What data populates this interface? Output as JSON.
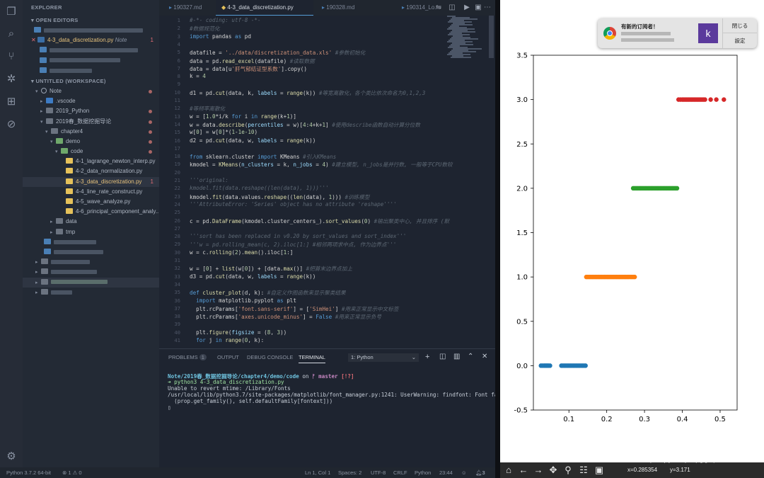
{
  "sidebar": {
    "explorer_title": "EXPLORER",
    "open_editors": "OPEN EDITORS",
    "active_file": "4-3_data_discretization.py",
    "note_label": "Note",
    "note_count": "1",
    "workspace": "UNTITLED (WORKSPACE)",
    "tree": [
      {
        "label": "Note",
        "depth": 0,
        "kind": "root",
        "dot": true
      },
      {
        "label": ".vscode",
        "depth": 1,
        "kind": "folder"
      },
      {
        "label": "2019_Python",
        "depth": 1,
        "kind": "folder",
        "dot": true
      },
      {
        "label": "2019春_数据挖掘导论",
        "depth": 1,
        "kind": "folder-open",
        "dot": true
      },
      {
        "label": "chapter4",
        "depth": 2,
        "kind": "folder-open",
        "dot": true
      },
      {
        "label": "demo",
        "depth": 3,
        "kind": "folder-open",
        "dot": true
      },
      {
        "label": "code",
        "depth": 4,
        "kind": "folder-open",
        "dot": true
      },
      {
        "label": "4-1_lagrange_newton_interp.py",
        "depth": 5,
        "kind": "py"
      },
      {
        "label": "4-2_data_normalization.py",
        "depth": 5,
        "kind": "py"
      },
      {
        "label": "4-3_data_discretization.py",
        "depth": 5,
        "kind": "py",
        "num": "1",
        "active": true
      },
      {
        "label": "4-4_line_rate_construct.py",
        "depth": 5,
        "kind": "py"
      },
      {
        "label": "4-5_wave_analyze.py",
        "depth": 5,
        "kind": "py"
      },
      {
        "label": "4-6_principal_component_analy...",
        "depth": 5,
        "kind": "py"
      },
      {
        "label": "data",
        "depth": 3,
        "kind": "folder"
      },
      {
        "label": "tmp",
        "depth": 3,
        "kind": "folder"
      }
    ],
    "outline": "OUTLINE"
  },
  "tabs": [
    "190327.md",
    "4-3_data_discretization.py",
    "190328.md",
    "190314_Lo..."
  ],
  "editor": {
    "lines": [
      [
        [
          "c",
          "#-*- coding: utf-8 -*-"
        ]
      ],
      [
        [
          "c",
          "#数据规范化"
        ]
      ],
      [
        [
          "k",
          "import"
        ],
        [
          "o",
          " pandas "
        ],
        [
          "k",
          "as"
        ],
        [
          "o",
          " pd"
        ]
      ],
      [],
      [
        [
          "o",
          "datafile = "
        ],
        [
          "s",
          "'../data/discretization_data.xls'"
        ],
        [
          "c",
          " #参数初始化"
        ]
      ],
      [
        [
          "o",
          "data = pd."
        ],
        [
          "f",
          "read_excel"
        ],
        [
          "o",
          "(datafile) "
        ],
        [
          "c",
          "#读取数据"
        ]
      ],
      [
        [
          "o",
          "data = data[u"
        ],
        [
          "s",
          "'肝气郁结证型系数'"
        ],
        [
          "o",
          "].copy()"
        ]
      ],
      [
        [
          "o",
          "k = "
        ],
        [
          "n",
          "4"
        ]
      ],
      [],
      [
        [
          "o",
          "d1 = pd."
        ],
        [
          "f",
          "cut"
        ],
        [
          "o",
          "(data, k, "
        ],
        [
          "v",
          "labels"
        ],
        [
          "o",
          " = "
        ],
        [
          "f",
          "range"
        ],
        [
          "o",
          "(k)) "
        ],
        [
          "c",
          "#等宽离散化，各个类比依次命名为0,1,2,3"
        ]
      ],
      [],
      [
        [
          "c",
          "#等频率离散化"
        ]
      ],
      [
        [
          "o",
          "w = ["
        ],
        [
          "n",
          "1.0"
        ],
        [
          "o",
          "*i/k "
        ],
        [
          "k",
          "for"
        ],
        [
          "o",
          " i "
        ],
        [
          "k",
          "in"
        ],
        [
          "o",
          " "
        ],
        [
          "f",
          "range"
        ],
        [
          "o",
          "(k+"
        ],
        [
          "n",
          "1"
        ],
        [
          "o",
          ")]"
        ]
      ],
      [
        [
          "o",
          "w = data."
        ],
        [
          "f",
          "describe"
        ],
        [
          "o",
          "("
        ],
        [
          "v",
          "percentiles"
        ],
        [
          "o",
          " = w)["
        ],
        [
          "n",
          "4"
        ],
        [
          "o",
          ":"
        ],
        [
          "n",
          "4"
        ],
        [
          "o",
          "+k+"
        ],
        [
          "n",
          "1"
        ],
        [
          "o",
          "] "
        ],
        [
          "c",
          "#使用describe函数自动计算分位数"
        ]
      ],
      [
        [
          "o",
          "w["
        ],
        [
          "n",
          "0"
        ],
        [
          "o",
          "] = w["
        ],
        [
          "n",
          "0"
        ],
        [
          "o",
          "]*("
        ],
        [
          "n",
          "1"
        ],
        [
          "o",
          "-"
        ],
        [
          "n",
          "1e-10"
        ],
        [
          "o",
          ")"
        ]
      ],
      [
        [
          "o",
          "d2 = pd."
        ],
        [
          "f",
          "cut"
        ],
        [
          "o",
          "(data, w, "
        ],
        [
          "v",
          "labels"
        ],
        [
          "o",
          " = "
        ],
        [
          "f",
          "range"
        ],
        [
          "o",
          "(k))"
        ]
      ],
      [],
      [
        [
          "k",
          "from"
        ],
        [
          "o",
          " sklearn.cluster "
        ],
        [
          "k",
          "import"
        ],
        [
          "o",
          " KMeans "
        ],
        [
          "c",
          "#引入KMeans"
        ]
      ],
      [
        [
          "o",
          "kmodel = "
        ],
        [
          "f",
          "KMeans"
        ],
        [
          "o",
          "("
        ],
        [
          "v",
          "n_clusters"
        ],
        [
          "o",
          " = k, "
        ],
        [
          "v",
          "n_jobs"
        ],
        [
          "o",
          " = "
        ],
        [
          "n",
          "4"
        ],
        [
          "o",
          ") "
        ],
        [
          "c",
          "#建立模型, n_jobs是并行数, 一般等于CPU数较"
        ]
      ],
      [],
      [
        [
          "c",
          "'''original:"
        ]
      ],
      [
        [
          "c",
          "kmodel.fit(data.reshape((len(data), 1)))'''"
        ]
      ],
      [
        [
          "o",
          "kmodel."
        ],
        [
          "f",
          "fit"
        ],
        [
          "o",
          "(data.values."
        ],
        [
          "f",
          "reshape"
        ],
        [
          "o",
          "(("
        ],
        [
          "f",
          "len"
        ],
        [
          "o",
          "(data), "
        ],
        [
          "n",
          "1"
        ],
        [
          "o",
          "))) "
        ],
        [
          "c",
          "#训练模型"
        ]
      ],
      [
        [
          "c",
          "'''AttributeError: 'Series' object has no attribute 'reshape''''"
        ]
      ],
      [],
      [
        [
          "o",
          "c = pd."
        ],
        [
          "f",
          "DataFrame"
        ],
        [
          "o",
          "(kmodel.cluster_centers_)."
        ],
        [
          "f",
          "sort_values"
        ],
        [
          "o",
          "("
        ],
        [
          "n",
          "0"
        ],
        [
          "o",
          ") "
        ],
        [
          "c",
          "#输出聚类中心, 并且排序 (默"
        ]
      ],
      [],
      [
        [
          "c",
          "'''sort has been replaced in v0.20 by sort_values and sort_index'''"
        ]
      ],
      [
        [
          "c",
          "'''w = pd.rolling_mean(c, 2).iloc[1:] #相邻两项求中点, 作为边界点'''"
        ]
      ],
      [
        [
          "o",
          "w = c."
        ],
        [
          "f",
          "rolling"
        ],
        [
          "o",
          "("
        ],
        [
          "n",
          "2"
        ],
        [
          "o",
          ")."
        ],
        [
          "f",
          "mean"
        ],
        [
          "o",
          "().iloc["
        ],
        [
          "n",
          "1"
        ],
        [
          "o",
          ":]"
        ]
      ],
      [],
      [
        [
          "o",
          "w = ["
        ],
        [
          "n",
          "0"
        ],
        [
          "o",
          "] + "
        ],
        [
          "f",
          "list"
        ],
        [
          "o",
          "(w["
        ],
        [
          "n",
          "0"
        ],
        [
          "o",
          "]) + [data."
        ],
        [
          "f",
          "max"
        ],
        [
          "o",
          "()] "
        ],
        [
          "c",
          "#把首末边界点加上"
        ]
      ],
      [
        [
          "o",
          "d3 = pd."
        ],
        [
          "f",
          "cut"
        ],
        [
          "o",
          "(data, w, "
        ],
        [
          "v",
          "labels"
        ],
        [
          "o",
          " = "
        ],
        [
          "f",
          "range"
        ],
        [
          "o",
          "(k))"
        ]
      ],
      [],
      [
        [
          "k",
          "def"
        ],
        [
          "o",
          " "
        ],
        [
          "f",
          "cluster_plot"
        ],
        [
          "o",
          "(d, k): "
        ],
        [
          "c",
          "#自定义作图函数来显示聚类结果"
        ]
      ],
      [
        [
          "o",
          "  "
        ],
        [
          "k",
          "import"
        ],
        [
          "o",
          " matplotlib.pyplot "
        ],
        [
          "k",
          "as"
        ],
        [
          "o",
          " plt"
        ]
      ],
      [
        [
          "o",
          "  plt.rcParams["
        ],
        [
          "s",
          "'font.sans-serif'"
        ],
        [
          "o",
          "] = ["
        ],
        [
          "s",
          "'SimHei'"
        ],
        [
          "o",
          "] "
        ],
        [
          "c",
          "#用来正常显示中文标签"
        ]
      ],
      [
        [
          "o",
          "  plt.rcParams["
        ],
        [
          "s",
          "'axes.unicode_minus'"
        ],
        [
          "o",
          "] = "
        ],
        [
          "k",
          "False"
        ],
        [
          "o",
          " "
        ],
        [
          "c",
          "#用来正常显示负号"
        ]
      ],
      [],
      [
        [
          "o",
          "  plt."
        ],
        [
          "f",
          "figure"
        ],
        [
          "o",
          "("
        ],
        [
          "v",
          "figsize"
        ],
        [
          "o",
          " = ("
        ],
        [
          "n",
          "8"
        ],
        [
          "o",
          ", "
        ],
        [
          "n",
          "3"
        ],
        [
          "o",
          "))"
        ]
      ],
      [
        [
          "o",
          "  "
        ],
        [
          "k",
          "for"
        ],
        [
          "o",
          " j "
        ],
        [
          "k",
          "in"
        ],
        [
          "o",
          " "
        ],
        [
          "f",
          "range"
        ],
        [
          "o",
          "("
        ],
        [
          "n",
          "0"
        ],
        [
          "o",
          ", k):"
        ]
      ]
    ]
  },
  "panel": {
    "tabs": [
      "PROBLEMS",
      "OUTPUT",
      "DEBUG CONSOLE",
      "TERMINAL"
    ],
    "problems_count": "1",
    "terminal_select": "1: Python",
    "terminal": {
      "prompt_path": "Note/2019春_数据挖掘导论/chapter4/demo/code",
      "on": " on ",
      "branch": "ᚠ master",
      "branch_status": "[!?]",
      "command": "➜ python3 4-3_data_discretization.py",
      "out1": "Unable to revert mtime: /Library/Fonts",
      "out2": "/usr/local/lib/python3.7/site-packages/matplotlib/font_manager.py:1241: UserWarning: findfont: Font fam",
      "out3": "  (prop.get_family(), self.defaultFamily[fontext]))",
      "cursor": "▯"
    }
  },
  "status": {
    "python": "Python 3.7.2 64-bit",
    "errors": "⊗ 1  ⚠ 0",
    "pos": "Ln 1, Col 1",
    "spaces": "Spaces: 2",
    "enc": "UTF-8",
    "eol": "CRLF",
    "lang": "Python",
    "time": "23:44",
    "bell": "3"
  },
  "notification": {
    "title": "有新的订阅者！",
    "close": "閉じる",
    "settings": "設定",
    "avatar": "k"
  },
  "plot_toolbar": {
    "coords_x": "x=0.285354",
    "coords_y": "y=3.171",
    "watermark": "值 什么值得买"
  },
  "chart_data": {
    "type": "scatter",
    "xlim": [
      0.006,
      0.545
    ],
    "ylim": [
      -0.5,
      3.5
    ],
    "xticks": [
      0.1,
      0.2,
      0.3,
      0.4,
      0.5
    ],
    "yticks": [
      -0.5,
      0.0,
      0.5,
      1.0,
      1.5,
      2.0,
      2.5,
      3.0,
      3.5
    ],
    "series": [
      {
        "color": "#1f77b4",
        "y": 0,
        "x": [
          0.026,
          0.03,
          0.034,
          0.037,
          0.04,
          0.043,
          0.046,
          0.05,
          0.08,
          0.084,
          0.088,
          0.092,
          0.096,
          0.1,
          0.104,
          0.108,
          0.112,
          0.116,
          0.12,
          0.124,
          0.128,
          0.132,
          0.136,
          0.14,
          0.144
        ]
      },
      {
        "color": "#ff7f0e",
        "y": 1,
        "x": [
          0.146,
          0.15,
          0.154,
          0.158,
          0.162,
          0.166,
          0.17,
          0.174,
          0.178,
          0.182,
          0.186,
          0.19,
          0.194,
          0.198,
          0.202,
          0.206,
          0.21,
          0.214,
          0.218,
          0.222,
          0.226,
          0.23,
          0.234,
          0.238,
          0.242,
          0.246,
          0.25,
          0.254,
          0.258,
          0.262,
          0.266,
          0.27,
          0.274
        ]
      },
      {
        "color": "#2ca02c",
        "y": 2,
        "x": [
          0.27,
          0.274,
          0.278,
          0.282,
          0.286,
          0.29,
          0.294,
          0.298,
          0.302,
          0.306,
          0.31,
          0.314,
          0.318,
          0.322,
          0.326,
          0.33,
          0.334,
          0.338,
          0.342,
          0.346,
          0.35,
          0.354,
          0.358,
          0.362,
          0.366,
          0.37,
          0.374,
          0.378,
          0.382,
          0.386
        ]
      },
      {
        "color": "#d62728",
        "y": 3,
        "x": [
          0.39,
          0.395,
          0.4,
          0.404,
          0.408,
          0.412,
          0.416,
          0.42,
          0.424,
          0.428,
          0.432,
          0.436,
          0.44,
          0.444,
          0.448,
          0.452,
          0.456,
          0.46,
          0.475,
          0.49,
          0.51
        ]
      }
    ]
  }
}
